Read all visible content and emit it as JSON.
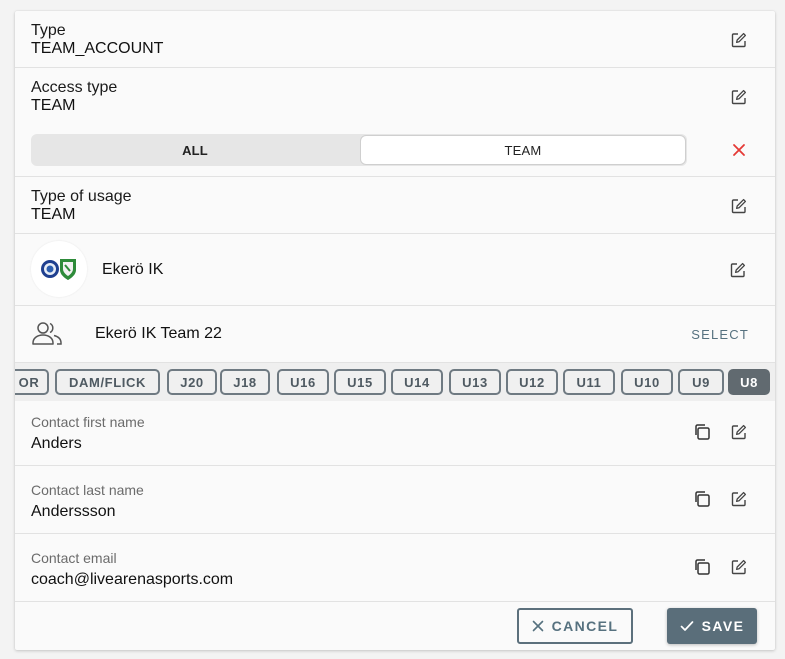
{
  "type_field": {
    "label": "Type",
    "value": "TEAM_ACCOUNT"
  },
  "access_type": {
    "label": "Access type",
    "value": "TEAM",
    "options": [
      "ALL",
      "TEAM"
    ],
    "selected": "TEAM"
  },
  "usage_type": {
    "label": "Type of usage",
    "value": "TEAM"
  },
  "club": {
    "name": "Ekerö IK"
  },
  "team": {
    "name": "Ekerö IK Team 22",
    "select_label": "SELECT"
  },
  "age_groups": [
    "OR",
    "DAM/FLICK",
    "J20",
    "J18",
    "U16",
    "U15",
    "U14",
    "U13",
    "U12",
    "U11",
    "U10",
    "U9",
    "U8"
  ],
  "age_group_selected": "U8",
  "contact": {
    "first_name": {
      "label": "Contact first name",
      "value": "Anders"
    },
    "last_name": {
      "label": "Contact last name",
      "value": "Anderssson"
    },
    "email": {
      "label": "Contact email",
      "value": "coach@livearenasports.com"
    }
  },
  "footer": {
    "cancel_label": "CANCEL",
    "save_label": "SAVE"
  },
  "colors": {
    "accent": "#5a6e7a",
    "clear": "#e53935",
    "chip_border": "#6f7a82"
  },
  "icons": {
    "edit": "edit-icon",
    "copy": "copy-icon",
    "clear": "close-icon",
    "group": "group-icon",
    "check": "check-icon"
  }
}
